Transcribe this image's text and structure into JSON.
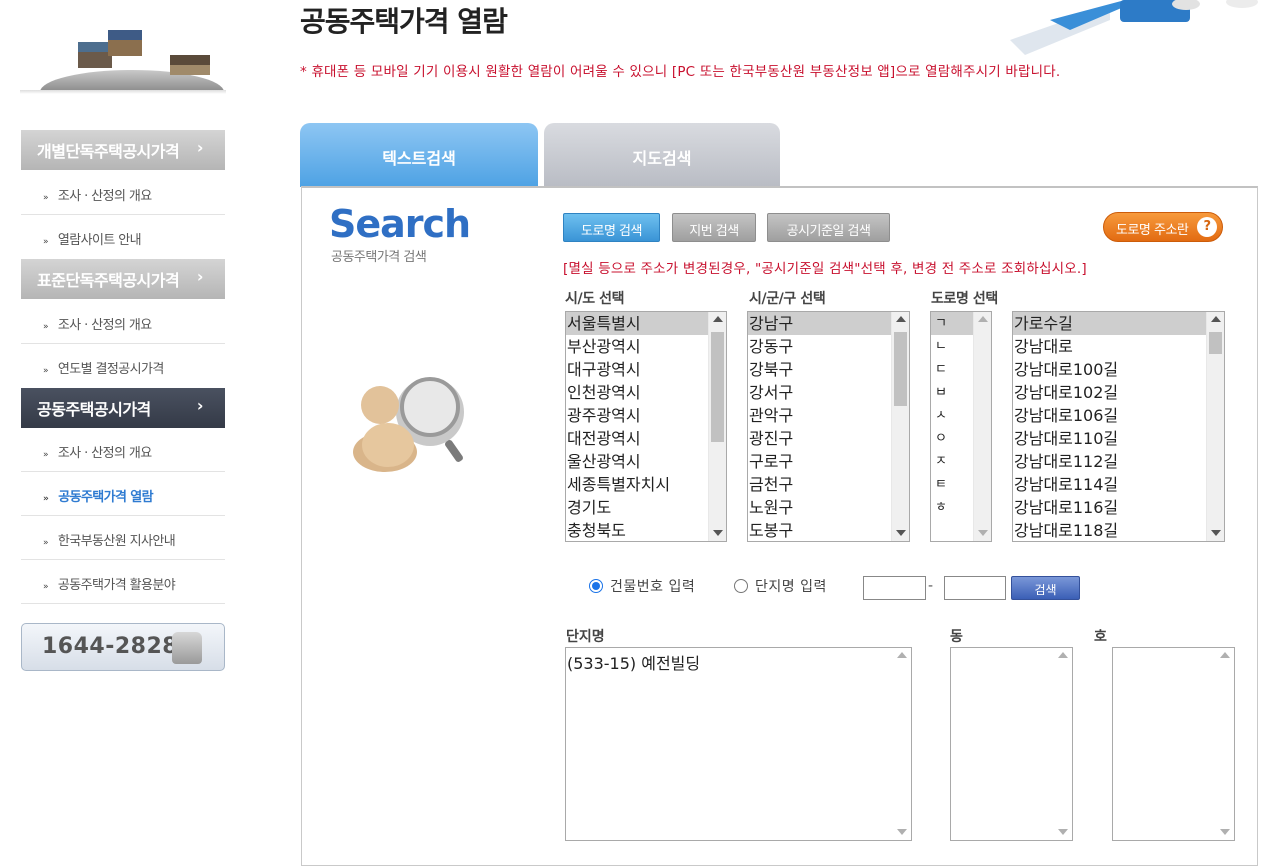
{
  "header": {
    "title": "공동주택가격 열람",
    "notice": "* 휴대폰 등 모바일 기기 이용시 원활한 열람이 어려울 수 있으니 [PC 또는 한국부동산원 부동산정보 앱]으로 열람해주시기 바랍니다."
  },
  "sidebar": {
    "sections": [
      {
        "title": "개별단독주택공시가격",
        "arrow": "›",
        "items": [
          "조사 · 산정의 개요",
          "열람사이트 안내"
        ]
      },
      {
        "title": "표준단독주택공시가격",
        "arrow": "›",
        "items": [
          "조사 · 산정의 개요",
          "연도별 결정공시가격"
        ]
      },
      {
        "title": "공동주택공시가격",
        "arrow": "›",
        "items": [
          "조사 · 산정의 개요",
          "공동주택가격 열람",
          "한국부동산원 지사안내",
          "공동주택가격 활용분야"
        ]
      }
    ],
    "bullet": "»",
    "phone": "1644-2828"
  },
  "tabs": [
    "텍스트검색",
    "지도검색"
  ],
  "search_logo": {
    "title": "Search",
    "subtitle": "공동주택가격 검색"
  },
  "buttons": {
    "road": "도로명 검색",
    "lot": "지번 검색",
    "date": "공시기준일 검색",
    "road_help": "도로명 주소란",
    "help_mark": "?"
  },
  "warning": "[멸실 등으로 주소가 변경된경우, \"공시기준일 검색\"선택 후, 변경 전 주소로 조회하십시오.]",
  "labels": {
    "sido": "시/도 선택",
    "sigungu": "시/군/구 선택",
    "road": "도로명 선택",
    "complex": "단지명",
    "dong": "동",
    "ho": "호"
  },
  "lists": {
    "sido": [
      "서울특별시",
      "부산광역시",
      "대구광역시",
      "인천광역시",
      "광주광역시",
      "대전광역시",
      "울산광역시",
      "세종특별자치시",
      "경기도",
      "충청북도"
    ],
    "sigungu": [
      "강남구",
      "강동구",
      "강북구",
      "강서구",
      "관악구",
      "광진구",
      "구로구",
      "금천구",
      "노원구",
      "도봉구"
    ],
    "initials": [
      "ㄱ",
      "ㄴ",
      "ㄷ",
      "ㅂ",
      "ㅅ",
      "ㅇ",
      "ㅈ",
      "ㅌ",
      "ㅎ"
    ],
    "roads": [
      "가로수길",
      "강남대로",
      "강남대로100길",
      "강남대로102길",
      "강남대로106길",
      "강남대로110길",
      "강남대로112길",
      "강남대로114길",
      "강남대로116길",
      "강남대로118길"
    ],
    "complex": [
      "(533-15) 예전빌딩"
    ]
  },
  "input_mode": {
    "building": "건물번호 입력",
    "complex": "단지명 입력",
    "selected": "building",
    "search": "검색",
    "dash": "-"
  }
}
